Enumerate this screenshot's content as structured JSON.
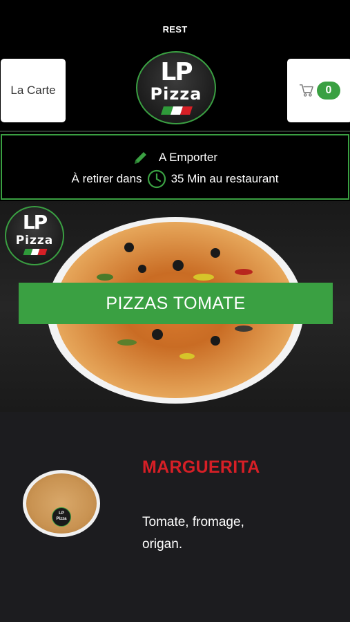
{
  "status": {
    "title": "REST"
  },
  "header": {
    "menu_button": "La Carte",
    "cart_count": "0",
    "logo_initials": "LP",
    "logo_word": "Pizza"
  },
  "order": {
    "mode": "A Emporter",
    "pickup_prefix": "À retirer dans",
    "pickup_time": "35 Min au restaurant"
  },
  "hero": {
    "category": "PIZZAS TOMATE",
    "logo_initials": "LP",
    "logo_word": "Pizza"
  },
  "items": [
    {
      "name": "MARGUERITA",
      "description": "Tomate, fromage, origan."
    }
  ],
  "colors": {
    "accent": "#3aa042",
    "item_name": "#d61f26",
    "background": "#000000",
    "list_background": "#1c1c1f"
  }
}
